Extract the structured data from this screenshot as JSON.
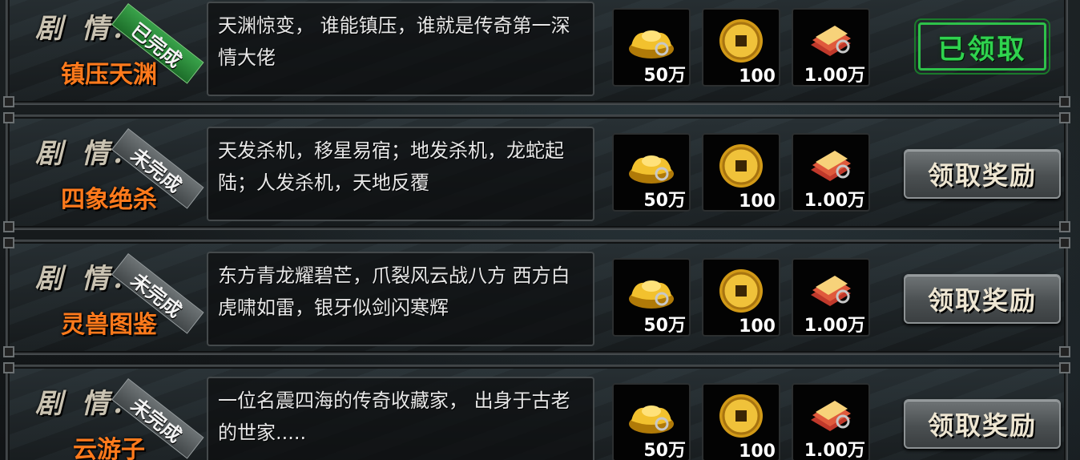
{
  "quests": [
    {
      "plot_label": "剧 情:",
      "name": "镇压天渊",
      "status": "已完成",
      "description": "天渊惊变， 谁能镇压，谁就是传奇第一深情大佬",
      "rewards": [
        {
          "icon": "gold-ingot-icon",
          "count": "50万"
        },
        {
          "icon": "copper-coin-icon",
          "count": "100"
        },
        {
          "icon": "red-envelope-stack-icon",
          "count": "1.00万"
        }
      ],
      "action_label": "已领取"
    },
    {
      "plot_label": "剧 情:",
      "name": "四象绝杀",
      "status": "未完成",
      "description": "天发杀机，移星易宿；地发杀机，龙蛇起陆；人发杀机，天地反覆",
      "rewards": [
        {
          "icon": "gold-ingot-icon",
          "count": "50万"
        },
        {
          "icon": "copper-coin-icon",
          "count": "100"
        },
        {
          "icon": "red-envelope-stack-icon",
          "count": "1.00万"
        }
      ],
      "action_label": "领取奖励"
    },
    {
      "plot_label": "剧 情:",
      "name": "灵兽图鉴",
      "status": "未完成",
      "description": "东方青龙耀碧芒，爪裂风云战八方 西方白虎啸如雷，银牙似剑闪寒辉",
      "rewards": [
        {
          "icon": "gold-ingot-icon",
          "count": "50万"
        },
        {
          "icon": "copper-coin-icon",
          "count": "100"
        },
        {
          "icon": "red-envelope-stack-icon",
          "count": "1.00万"
        }
      ],
      "action_label": "领取奖励"
    },
    {
      "plot_label": "剧 情:",
      "name": "云游子",
      "status": "未完成",
      "description": "一位名震四海的传奇收藏家， 出身于古老的世家.....",
      "rewards": [
        {
          "icon": "gold-ingot-icon",
          "count": "50万"
        },
        {
          "icon": "copper-coin-icon",
          "count": "100"
        },
        {
          "icon": "red-envelope-stack-icon",
          "count": "1.00万"
        }
      ],
      "action_label": "领取奖励"
    }
  ],
  "colors": {
    "quest_name": "#ff7a1c",
    "done_green": "#2fd34e"
  }
}
